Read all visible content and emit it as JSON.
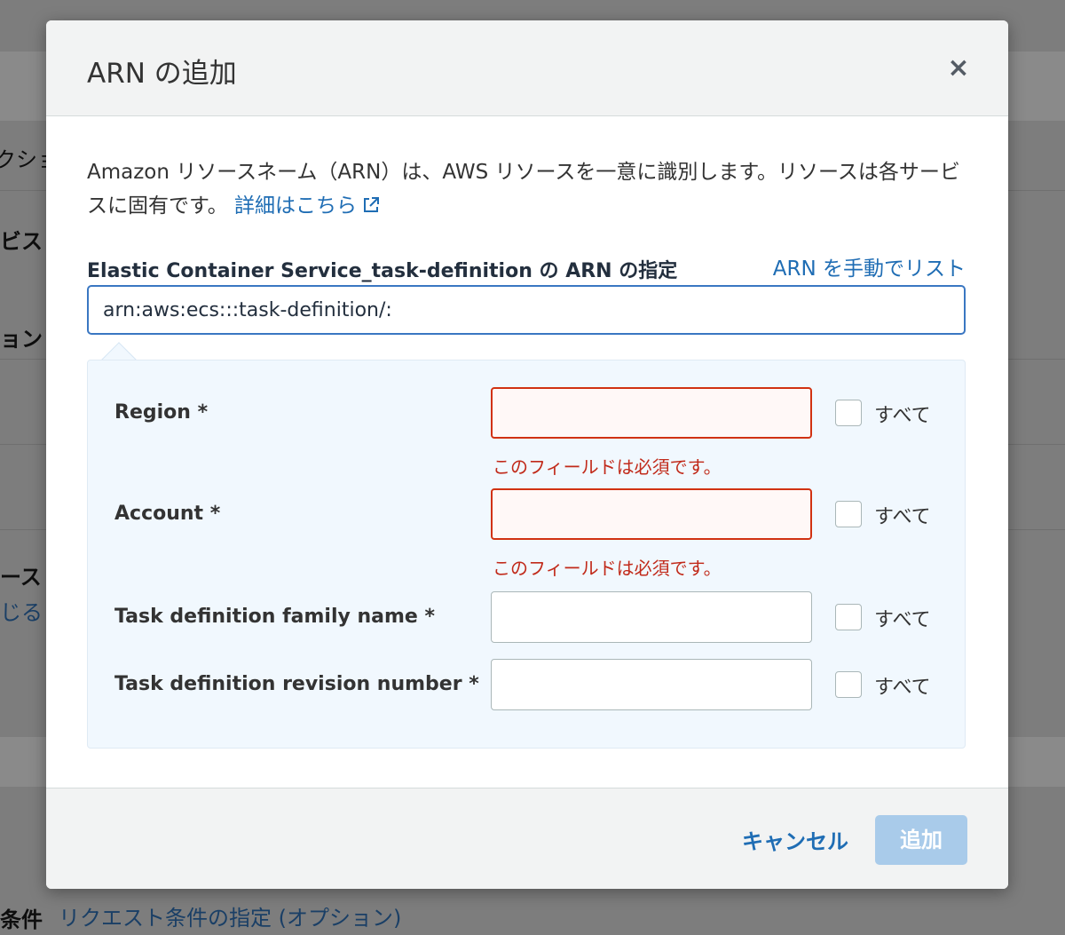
{
  "background": {
    "left_fragments": [
      "クショ",
      "ビス",
      "ョン",
      "ース",
      "じる"
    ],
    "bottom_label": "条件",
    "bottom_link": "リクエスト条件の指定 (オプション)"
  },
  "modal": {
    "title": "ARN の追加",
    "close_label": "×",
    "description": "Amazon リソースネーム（ARN）は、AWS リソースを一意に識別します。リソースは各サービスに固有です。",
    "learn_more": "詳細はこちら",
    "field_label": "Elastic Container Service_task-definition の ARN の指定",
    "manual_link": "ARN を手動でリスト",
    "arn_value": "arn:aws:ecs:::task-definition/:",
    "rows": [
      {
        "label": "Region *",
        "value": "",
        "error": "このフィールドは必須です。",
        "checkbox_label": "すべて"
      },
      {
        "label": "Account *",
        "value": "",
        "error": "このフィールドは必須です。",
        "checkbox_label": "すべて"
      },
      {
        "label": "Task definition family name *",
        "value": "",
        "error": "",
        "checkbox_label": "すべて"
      },
      {
        "label": "Task definition revision number *",
        "value": "",
        "error": "",
        "checkbox_label": "すべて"
      }
    ],
    "cancel_label": "キャンセル",
    "add_label": "追加"
  },
  "colors": {
    "link": "#1f6db4",
    "error": "#d13212",
    "add_button_disabled": "#a9cbea"
  }
}
